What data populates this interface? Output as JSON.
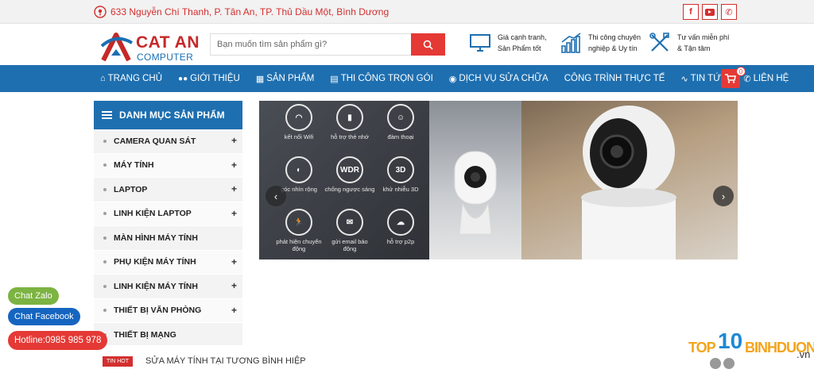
{
  "topbar": {
    "address": "633 Nguyễn Chí Thanh, P. Tân An, TP. Thủ Dầu Một, Bình Dương",
    "socials": [
      {
        "icon": "facebook-icon",
        "glyph": "f"
      },
      {
        "icon": "youtube-icon",
        "glyph": "▶"
      },
      {
        "icon": "phone-icon",
        "glyph": "✆"
      }
    ]
  },
  "header": {
    "logo_brand": "CAT AN",
    "logo_sub": "COMPUTER",
    "search_placeholder": "Bạn muốn tìm sản phẩm gì?",
    "features": [
      {
        "line1": "Giá cạnh tranh,",
        "line2": "Sản Phẩm tốt",
        "icon": "monitor-icon"
      },
      {
        "line1": "Thi công chuyên",
        "line2": "nghiệp & Uy tín",
        "icon": "chart-icon"
      },
      {
        "line1": "Tư vấn miễn phí",
        "line2": "& Tận tâm",
        "icon": "tools-icon"
      }
    ]
  },
  "nav": {
    "items": [
      {
        "label": "TRANG CHỦ",
        "icon": "home-icon",
        "glyph": "⌂"
      },
      {
        "label": "GIỚI THIỆU",
        "icon": "users-icon",
        "glyph": "👥"
      },
      {
        "label": "SẢN PHẨM",
        "icon": "grid-icon",
        "glyph": "▦"
      },
      {
        "label": "THI CÔNG TRỌN GÓI",
        "icon": "list-icon",
        "glyph": "▤"
      },
      {
        "label": "DỊCH VỤ SỬA CHỮA",
        "icon": "dashboard-icon",
        "glyph": "◉"
      },
      {
        "label": "CÔNG TRÌNH THỰC TẾ",
        "icon": "",
        "glyph": ""
      },
      {
        "label": "TIN TỨC",
        "icon": "rss-icon",
        "glyph": "⟟"
      },
      {
        "label": "LIÊN HỆ",
        "icon": "phone-icon",
        "glyph": "✆"
      }
    ],
    "cart_count": "0"
  },
  "categories": {
    "title": "DANH MỤC SẢN PHẨM",
    "items": [
      {
        "label": "CAMERA QUAN SÁT",
        "expand": "+"
      },
      {
        "label": "MÁY TÍNH",
        "expand": "+"
      },
      {
        "label": "LAPTOP",
        "expand": "+"
      },
      {
        "label": "LINH KIỆN LAPTOP",
        "expand": "+"
      },
      {
        "label": "MÀN HÌNH MÁY TÍNH",
        "expand": ""
      },
      {
        "label": "PHỤ KIỆN MÁY TÍNH",
        "expand": "+"
      },
      {
        "label": "LINH KIỆN MÁY TÍNH",
        "expand": "+"
      },
      {
        "label": "THIẾT BỊ VĂN PHÒNG",
        "expand": "+"
      },
      {
        "label": "THIẾT BỊ MẠNG",
        "expand": ""
      }
    ]
  },
  "slider": {
    "features": [
      {
        "label": "kết nối Wifi",
        "glyph": "◠"
      },
      {
        "label": "hỗ trợ thẻ nhớ",
        "glyph": "▮"
      },
      {
        "label": "đàm thoại",
        "glyph": "☺"
      },
      {
        "label": "góc nhìn rộng",
        "glyph": "◐"
      },
      {
        "label": "chống ngược sáng",
        "glyph": "WDR"
      },
      {
        "label": "khử nhiễu 3D",
        "glyph": "3D"
      },
      {
        "label": "phát hiện chuyển động",
        "glyph": "🏃"
      },
      {
        "label": "gửi email báo động",
        "glyph": "✉"
      },
      {
        "label": "hỗ trợ p2p",
        "glyph": "☁"
      }
    ],
    "prev": "‹",
    "next": "›"
  },
  "chat": {
    "zalo": "Chat Zalo",
    "facebook": "Chat Facebook",
    "hotline": "Hotline:0985 985 978"
  },
  "news": {
    "badge": "TIN HOT",
    "headline": "SỬA MÁY TÍNH TẠI TƯƠNG BÌNH HIỆP"
  },
  "watermark": {
    "top": "TOP",
    "ten": "10",
    "bd": "BINHDUONG",
    "vn": ".vn"
  },
  "colors": {
    "accent_blue": "#1e6fb0",
    "accent_red": "#e53935",
    "zalo_green": "#7cb342",
    "facebook_blue": "#1565c0"
  }
}
